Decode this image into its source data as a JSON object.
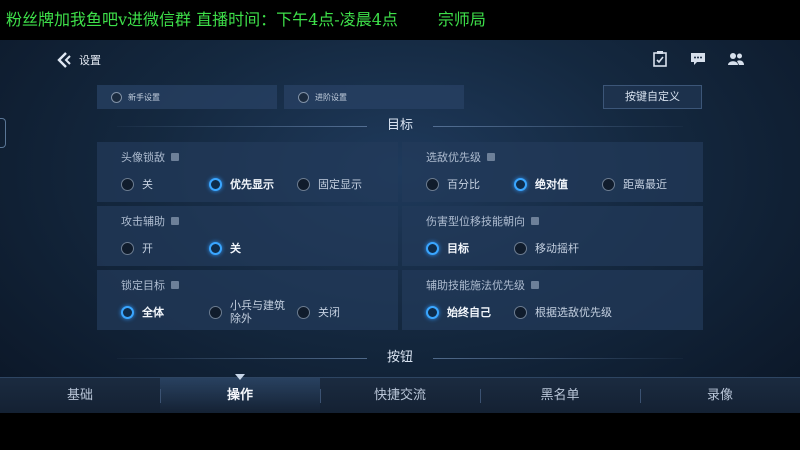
{
  "stream": {
    "banner": "粉丝牌加我鱼吧v进微信群 直播时间：下午4点-凌晨4点",
    "room": "宗师局"
  },
  "header": {
    "title": "设置"
  },
  "modes": {
    "novice": "新手设置",
    "advanced": "进阶设置",
    "key_define": "按键自定义"
  },
  "sections": {
    "target": "目标",
    "buttons": "按钮"
  },
  "cards": {
    "head_lock": {
      "label": "头像锁敌",
      "options": [
        "关",
        "优先显示",
        "固定显示"
      ],
      "selected": 1
    },
    "enemy_priority": {
      "label": "选敌优先级",
      "options": [
        "百分比",
        "绝对值",
        "距离最近"
      ],
      "selected": 1
    },
    "attack_assist": {
      "label": "攻击辅助",
      "options": [
        "开",
        "关"
      ],
      "selected": 1
    },
    "skill_direction": {
      "label": "伤害型位移技能朝向",
      "options": [
        "目标",
        "移动摇杆"
      ],
      "selected": 0
    },
    "lock_target": {
      "label": "锁定目标",
      "options": [
        "全体",
        "小兵与建筑",
        "除外",
        "关闭"
      ],
      "selected": 0
    },
    "assist_skill": {
      "label": "辅助技能施法优先级",
      "options": [
        "始终自己",
        "根据选敌优先级"
      ],
      "selected": 0
    }
  },
  "tabs": [
    "基础",
    "操作",
    "快捷交流",
    "黑名单",
    "录像"
  ],
  "active_tab": 1,
  "colors": {
    "accent": "#3aa6ff",
    "banner_text": "#3ee04a"
  }
}
